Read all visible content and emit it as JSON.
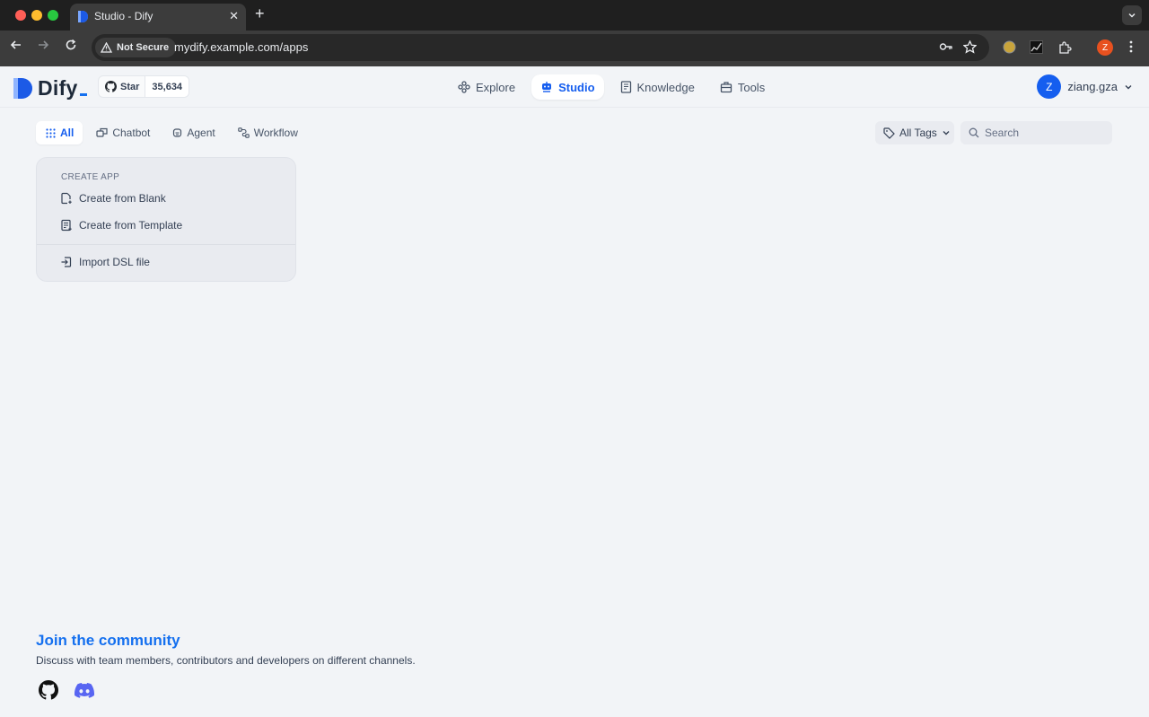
{
  "browser": {
    "tab_title": "Studio - Dify",
    "tab_close_glyph": "✕",
    "new_tab_glyph": "+",
    "security_label": "Not Secure",
    "url": "mydify.example.com/apps",
    "profile_initial": "Z"
  },
  "header": {
    "logo_text": "Dify",
    "github": {
      "star_label": "Star",
      "star_count": "35,634"
    },
    "nav": [
      {
        "label": "Explore",
        "icon": "explore-icon",
        "active": false
      },
      {
        "label": "Studio",
        "icon": "studio-robot-icon",
        "active": true
      },
      {
        "label": "Knowledge",
        "icon": "book-icon",
        "active": false
      },
      {
        "label": "Tools",
        "icon": "toolbox-icon",
        "active": false
      }
    ],
    "user": {
      "initial": "Z",
      "name": "ziang.gza"
    }
  },
  "filters": {
    "tabs": [
      {
        "label": "All",
        "icon": "grid-dots-icon",
        "active": true
      },
      {
        "label": "Chatbot",
        "icon": "chatbot-icon",
        "active": false
      },
      {
        "label": "Agent",
        "icon": "agent-icon",
        "active": false
      },
      {
        "label": "Workflow",
        "icon": "workflow-icon",
        "active": false
      }
    ],
    "tags_label": "All Tags",
    "search_placeholder": "Search"
  },
  "create_card": {
    "heading": "CREATE APP",
    "blank": "Create from Blank",
    "template": "Create from Template",
    "import": "Import DSL file"
  },
  "community": {
    "title": "Join the community",
    "description": "Discuss with team members, contributors and developers on different channels."
  },
  "colors": {
    "primary": "#155eef",
    "community_title": "#1570ef",
    "background": "#f2f4f7"
  }
}
